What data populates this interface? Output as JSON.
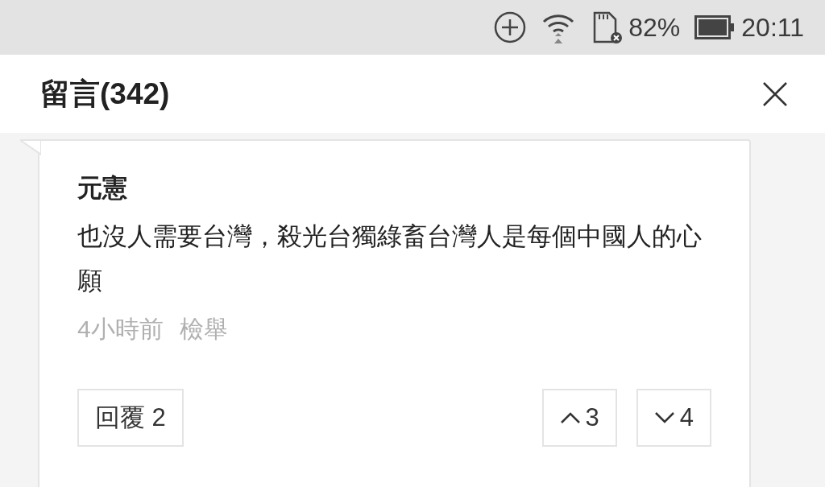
{
  "status_bar": {
    "battery": "82%",
    "time": "20:11"
  },
  "header": {
    "title": "留言(342)"
  },
  "comments": [
    {
      "author": "元憲",
      "text": "也沒人需要台灣，殺光台獨綠畜台灣人是每個中國人的心願",
      "time": "4小時前",
      "report": "檢舉",
      "reply_button": "回覆 2",
      "upvotes": "3",
      "downvotes": "4"
    }
  ]
}
